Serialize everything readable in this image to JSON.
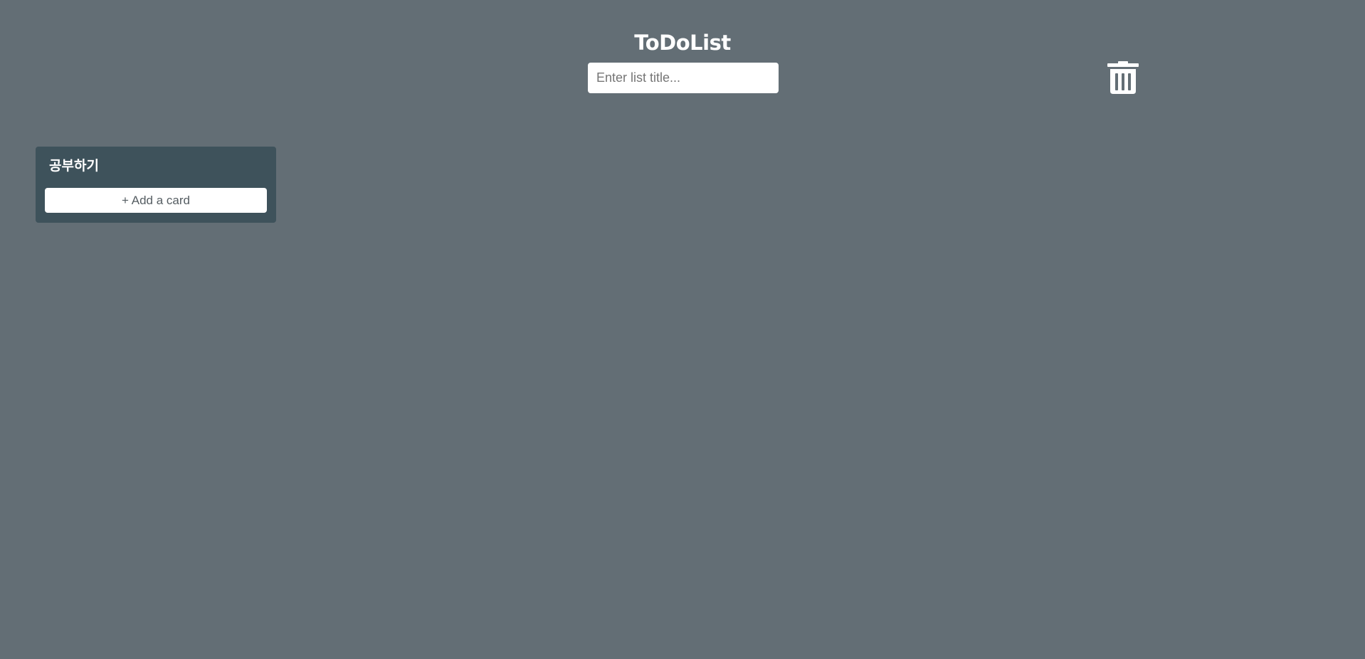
{
  "header": {
    "title": "ToDoList",
    "list_title_input": {
      "value": "",
      "placeholder": "Enter list title..."
    },
    "trash_icon": "trash-icon"
  },
  "board": {
    "lists": [
      {
        "title": "공부하기",
        "add_card_label": "+ Add a card"
      }
    ]
  },
  "colors": {
    "background": "#636e75",
    "list_background": "#3e525b",
    "text_light": "#ffffff",
    "button_background": "#ffffff"
  }
}
